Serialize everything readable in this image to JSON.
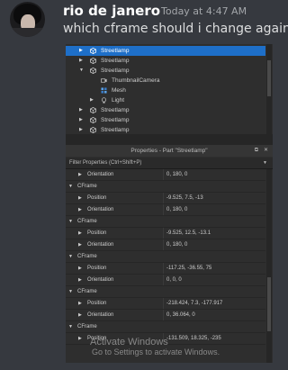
{
  "message": {
    "username": "rio de janero",
    "timestamp": "Today at 4:47 AM",
    "text": "which cframe should i change again"
  },
  "explorer": {
    "rows": [
      {
        "label": "Streetlamp",
        "selected": true
      },
      {
        "label": "Streetlamp"
      },
      {
        "label": "Streetlamp"
      },
      {
        "label": "ThumbnailCamera"
      },
      {
        "label": "Mesh"
      },
      {
        "label": "Light"
      },
      {
        "label": "Streetlamp"
      },
      {
        "label": "Streetlamp"
      },
      {
        "label": "Streetlamp"
      }
    ]
  },
  "properties": {
    "title": "Properties - Part \"Streetlamp\"",
    "filter_label": "Filter Properties (Ctrl+Shift+P)",
    "rows": [
      {
        "name": "Orientation",
        "value": "0, 180, 0"
      },
      {
        "name": "CFrame",
        "value": ""
      },
      {
        "name": "Position",
        "value": "-9.525, 7.5, -13"
      },
      {
        "name": "Orientation",
        "value": "0, 180, 0"
      },
      {
        "name": "CFrame",
        "value": ""
      },
      {
        "name": "Position",
        "value": "-9.525, 12.5, -13.1"
      },
      {
        "name": "Orientation",
        "value": "0, 180, 0"
      },
      {
        "name": "CFrame",
        "value": ""
      },
      {
        "name": "Position",
        "value": "-117.25, -36.55, 75"
      },
      {
        "name": "Orientation",
        "value": "0, 0, 0"
      },
      {
        "name": "CFrame",
        "value": ""
      },
      {
        "name": "Position",
        "value": "-218.424, 7.3, -177.917"
      },
      {
        "name": "Orientation",
        "value": "0, 36.064, 0"
      },
      {
        "name": "CFrame",
        "value": ""
      },
      {
        "name": "Position",
        "value": "-131.509, 18.325, -235"
      }
    ]
  },
  "watermark": {
    "line1": "Activate Windows",
    "line2": "Go to Settings to activate Windows."
  }
}
